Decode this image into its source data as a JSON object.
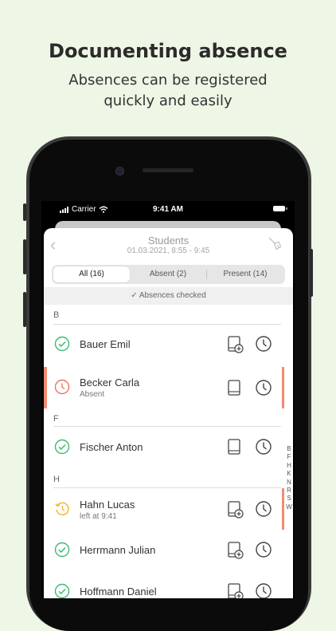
{
  "promo": {
    "headline": "Documenting absence",
    "subline": "Absences can be registered quickly and easily"
  },
  "statusbar": {
    "carrier": "Carrier",
    "time": "9:41 AM"
  },
  "nav": {
    "title": "Students",
    "subtitle": "01.03.2021, 8:55 - 9:45",
    "back_icon": "chevron-left-icon",
    "action_icon": "broom-icon"
  },
  "tabs": [
    {
      "label": "All (16)",
      "active": true
    },
    {
      "label": "Absent (2)",
      "active": false
    },
    {
      "label": "Present (14)",
      "active": false
    }
  ],
  "check_banner": "✓ Absences checked",
  "sections": {
    "b": "B",
    "f": "F",
    "h": "H"
  },
  "students": [
    {
      "name": "Bauer Emil",
      "sub": "",
      "status": "present",
      "book": "book-plus"
    },
    {
      "name": "Becker Carla",
      "sub": "Absent",
      "status": "absent",
      "book": "book"
    },
    {
      "name": "Fischer Anton",
      "sub": "",
      "status": "present",
      "book": "book"
    },
    {
      "name": "Hahn Lucas",
      "sub": "left at 9:41",
      "status": "left",
      "book": "book-plus"
    },
    {
      "name": "Herrmann Julian",
      "sub": "",
      "status": "present",
      "book": "book-plus"
    },
    {
      "name": "Hoffmann Daniel",
      "sub": "",
      "status": "present",
      "book": "book-plus"
    }
  ],
  "index_letters": [
    "B",
    "F",
    "H",
    "K",
    "N",
    "R",
    "S",
    "W"
  ],
  "colors": {
    "present": "#3dbb74",
    "absent": "#e8765f",
    "left": "#f2b636",
    "accent_bar": "#ef8c74"
  }
}
